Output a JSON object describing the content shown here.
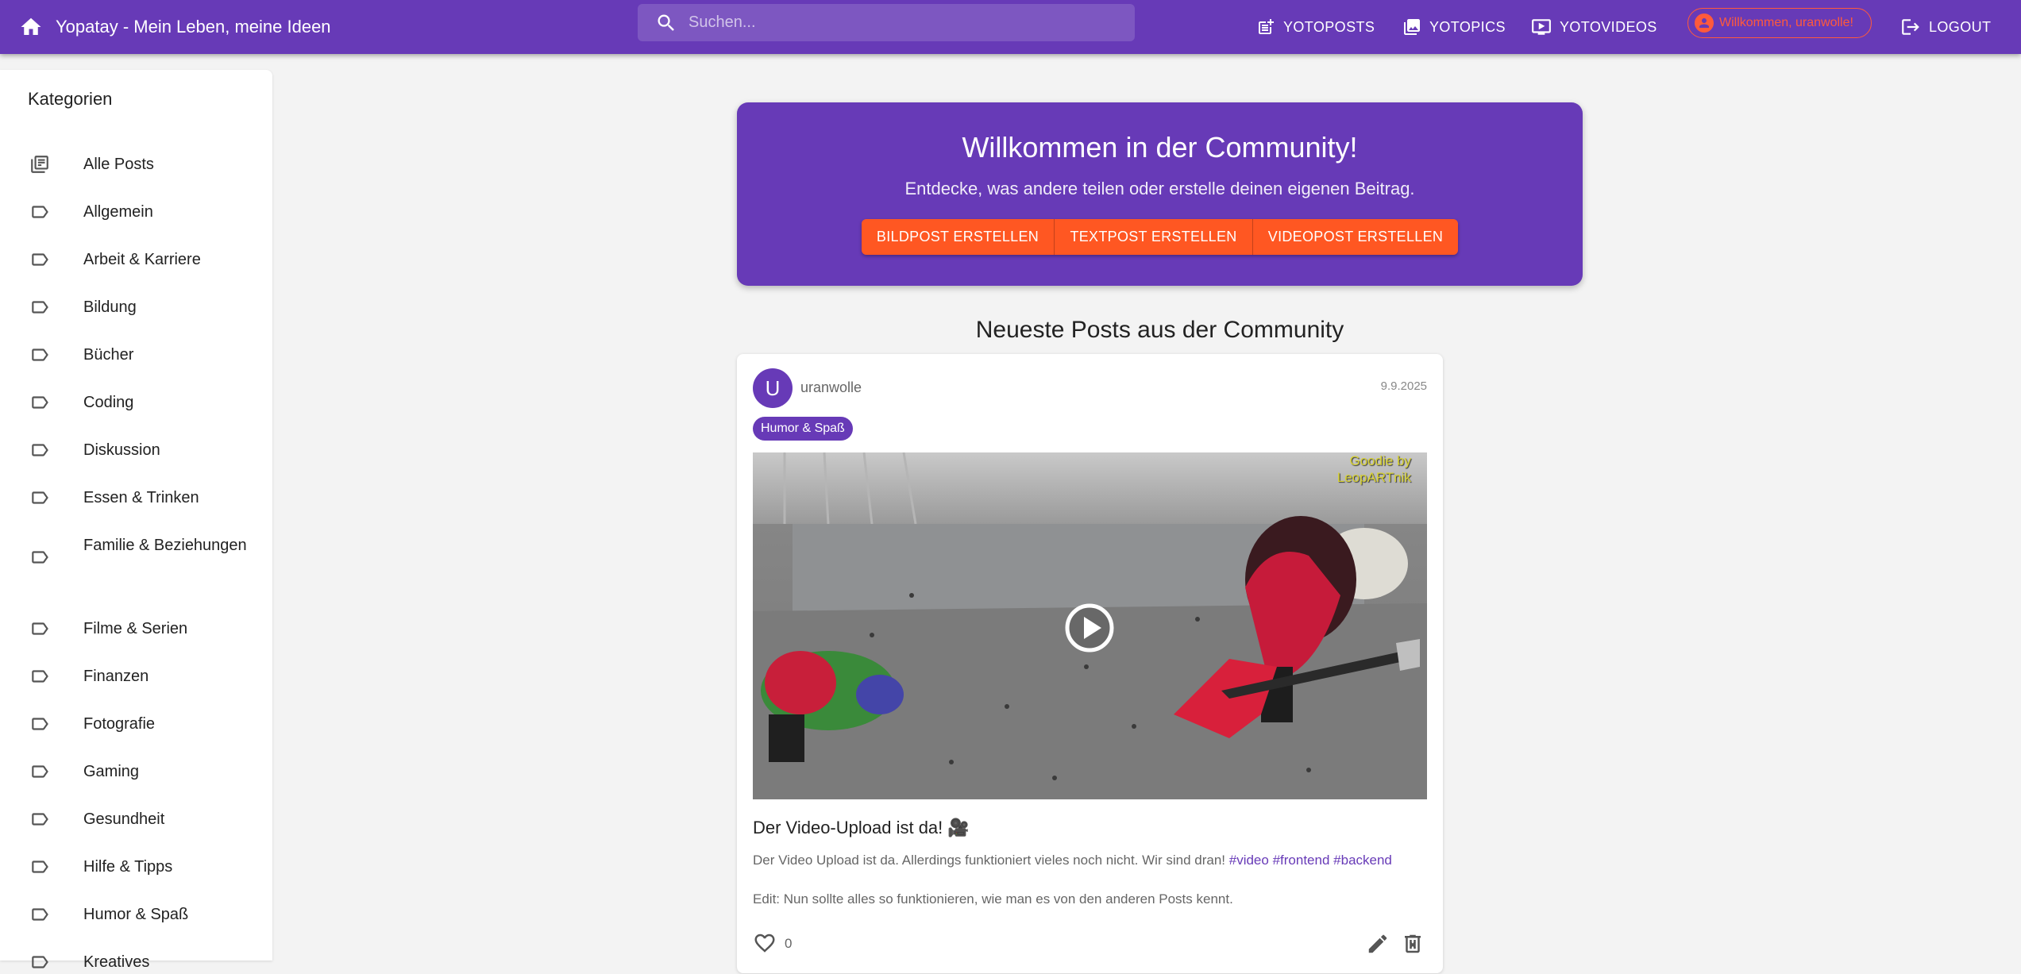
{
  "app": {
    "title": "Yopatay - Mein Leben, meine Ideen"
  },
  "search": {
    "placeholder": "Suchen..."
  },
  "nav": {
    "posts": "YOTOPOSTS",
    "pics": "YOTOPICS",
    "videos": "YOTOVIDEOS",
    "welcome": "Willkommen, uranwolle!",
    "logout": "LOGOUT"
  },
  "sidebar": {
    "title": "Kategorien",
    "items": [
      {
        "label": "Alle Posts",
        "icon": "library-icon"
      },
      {
        "label": "Allgemein",
        "icon": "label-icon"
      },
      {
        "label": "Arbeit & Karriere",
        "icon": "label-icon"
      },
      {
        "label": "Bildung",
        "icon": "label-icon"
      },
      {
        "label": "Bücher",
        "icon": "label-icon"
      },
      {
        "label": "Coding",
        "icon": "label-icon"
      },
      {
        "label": "Diskussion",
        "icon": "label-icon"
      },
      {
        "label": "Essen & Trinken",
        "icon": "label-icon"
      },
      {
        "label": "Familie & Beziehungen",
        "icon": "label-icon"
      },
      {
        "label": "Filme & Serien",
        "icon": "label-icon"
      },
      {
        "label": "Finanzen",
        "icon": "label-icon"
      },
      {
        "label": "Fotografie",
        "icon": "label-icon"
      },
      {
        "label": "Gaming",
        "icon": "label-icon"
      },
      {
        "label": "Gesundheit",
        "icon": "label-icon"
      },
      {
        "label": "Hilfe & Tipps",
        "icon": "label-icon"
      },
      {
        "label": "Humor & Spaß",
        "icon": "label-icon"
      },
      {
        "label": "Kreatives",
        "icon": "label-icon"
      }
    ]
  },
  "hero": {
    "title": "Willkommen in der Community!",
    "subtitle": "Entdecke, was andere teilen oder erstelle deinen eigenen Beitrag.",
    "btn_image": "BILDPOST ERSTELLEN",
    "btn_text": "TEXTPOST ERSTELLEN",
    "btn_video": "VIDEOPOST ERSTELLEN"
  },
  "feed": {
    "title": "Neueste Posts aus der Community"
  },
  "post": {
    "avatar_letter": "U",
    "author": "uranwolle",
    "date": "9.9.2025",
    "tag": "Humor & Spaß",
    "video_watermark_1": "Goodie by",
    "video_watermark_2": "LeopARTnik",
    "title": "Der Video-Upload ist da! 🎥",
    "body": "Der Video Upload ist da. Allerdings funktioniert vieles noch nicht. Wir sind dran!",
    "hashtags": [
      "#video",
      "#frontend",
      "#backend"
    ],
    "edit_note": "Edit: Nun sollte alles so funktionieren, wie man es von den anderen Posts kennt.",
    "likes": "0"
  },
  "colors": {
    "primary": "#673ab7",
    "accent": "#ff5722",
    "background": "#f3f3f3"
  }
}
